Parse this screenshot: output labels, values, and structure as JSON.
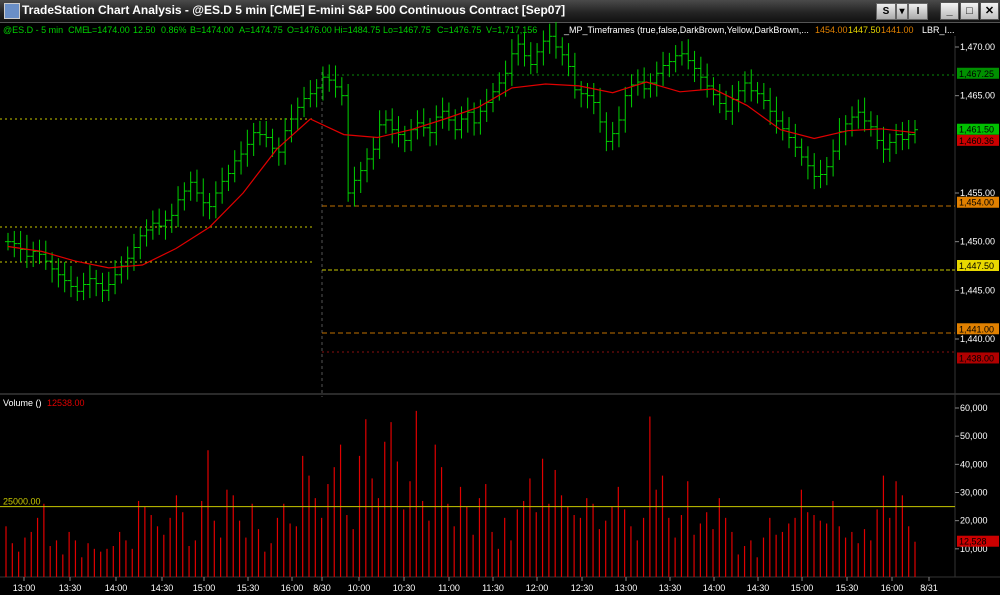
{
  "window": {
    "title": "TradeStation Chart Analysis - @ES.D  5 min  [CME] E-mini S&P 500 Continuous Contract [Sep07]",
    "btn_s": "S",
    "btn_i": "I",
    "minimize": "_",
    "maximize": "□",
    "close": "✕"
  },
  "header": {
    "symbol": "@ES.D - 5 min  CME",
    "last": "L=1474.00",
    "change": "12.50",
    "pct": "0.86%",
    "bid": "B=1474.00",
    "ask": "A=1474.75",
    "open": "O=1476.00",
    "high": "Hi=1484.75",
    "low": "Lo=1467.75",
    "close": "C=1476.75",
    "vol": "V=1,717,156",
    "indicator": "_MP_Timeframes (true,false,DarkBrown,Yellow,DarkBrown,...",
    "ind_v1": "1454.00",
    "ind_v2": "1447.50",
    "ind_v3": "1441.00",
    "ind_name2": "LBR_I..."
  },
  "volume_header": {
    "label": "Volume ()",
    "value": "12538.00"
  },
  "colors": {
    "bars": "#00d000",
    "ma": "#e00000",
    "volume": "#e00000",
    "guide": "#c8c800",
    "axis_text": "#ffffff",
    "background": "#000000"
  },
  "chart_data": [
    {
      "type": "ohlc",
      "ylim": [
        1436,
        1472
      ],
      "y_ticks": [
        "1,440.00",
        "1,445.00",
        "1,450.00",
        "1,455.00",
        "1,465.00",
        "1,470.00"
      ],
      "x_ticks": [
        "13:00",
        "13:30",
        "14:00",
        "14:30",
        "15:00",
        "15:30",
        "16:00",
        "8/30",
        "10:00",
        "10:30",
        "11:00",
        "11:30",
        "12:00",
        "12:30",
        "13:00",
        "13:30",
        "14:00",
        "14:30",
        "15:00",
        "15:30",
        "16:00",
        "8/31"
      ],
      "price_labels": [
        {
          "text": "1,467.25",
          "value": 1467.25,
          "bg": "#009000",
          "fg": "#000000"
        },
        {
          "text": "1,461.50",
          "value": 1461.5,
          "bg": "#00c000",
          "fg": "#000000"
        },
        {
          "text": "1,460.36",
          "value": 1460.36,
          "bg": "#cc0000",
          "fg": "#000000"
        },
        {
          "text": "1,454.00",
          "value": 1454.0,
          "bg": "#e08000",
          "fg": "#000000"
        },
        {
          "text": "1,447.50",
          "value": 1447.5,
          "bg": "#e8d800",
          "fg": "#000000"
        },
        {
          "text": "1,441.00",
          "value": 1441.0,
          "bg": "#e08000",
          "fg": "#000000"
        },
        {
          "text": "1,438.00",
          "value": 1438.0,
          "bg": "#b00000",
          "fg": "#000000"
        }
      ],
      "ohlc_closes": [
        1450.0,
        1449.8,
        1449.2,
        1448.5,
        1449.0,
        1448.7,
        1448.0,
        1447.2,
        1446.6,
        1446.0,
        1445.4,
        1444.9,
        1445.6,
        1446.2,
        1445.7,
        1445.0,
        1445.6,
        1446.6,
        1447.5,
        1448.3,
        1449.4,
        1450.6,
        1451.2,
        1451.9,
        1451.6,
        1452.2,
        1452.7,
        1454.3,
        1455.2,
        1456.1,
        1455.0,
        1454.0,
        1453.6,
        1455.0,
        1456.2,
        1457.0,
        1458.3,
        1459.0,
        1460.0,
        1461.2,
        1461.0,
        1460.7,
        1459.6,
        1459.2,
        1461.4,
        1462.6,
        1463.8,
        1464.7,
        1465.2,
        1465.8,
        1466.9,
        1466.6,
        1465.9,
        1465.0,
        1455.0,
        1456.3,
        1457.3,
        1458.5,
        1459.5,
        1462.0,
        1462.5,
        1461.5,
        1461.0,
        1460.4,
        1461.5,
        1462.2,
        1461.7,
        1461.2,
        1462.8,
        1463.4,
        1462.5,
        1461.5,
        1462.6,
        1463.3,
        1462.2,
        1463.4,
        1464.3,
        1465.4,
        1466.3,
        1467.3,
        1469.3,
        1470.3,
        1469.1,
        1468.2,
        1469.5,
        1470.6,
        1471.1,
        1470.0,
        1469.2,
        1468.0,
        1465.6,
        1465.2,
        1465.0,
        1464.3,
        1462.3,
        1460.3,
        1461.1,
        1462.5,
        1465.0,
        1466.1,
        1466.4,
        1465.7,
        1466.3,
        1467.3,
        1468.1,
        1468.5,
        1469.1,
        1469.3,
        1468.6,
        1467.8,
        1466.9,
        1466.0,
        1465.1,
        1464.2,
        1463.4,
        1464.6,
        1465.5,
        1466.3,
        1465.5,
        1465.2,
        1464.5,
        1463.4,
        1462.4,
        1461.6,
        1460.7,
        1459.7,
        1458.7,
        1457.8,
        1456.7,
        1456.9,
        1457.7,
        1459.3,
        1461.3,
        1462.1,
        1462.8,
        1463.3,
        1462.4,
        1461.8,
        1460.4,
        1459.5,
        1460.2,
        1461.0,
        1460.5,
        1461.0,
        1461.5
      ],
      "ma_values": [
        1449.5,
        1449.0,
        1448.0,
        1447.3,
        1447.6,
        1449.3,
        1451.5,
        1455.0,
        1459.5,
        1462.6,
        1461.0,
        1460.7,
        1461.5,
        1462.6,
        1463.8,
        1465.8,
        1466.2,
        1466.0,
        1465.3,
        1466.4,
        1465.4,
        1465.7,
        1464.0,
        1461.5,
        1460.6,
        1461.4,
        1461.6,
        1461.2
      ]
    },
    {
      "type": "bar",
      "title": "Volume ()",
      "ylim": [
        0,
        65000
      ],
      "y_ticks": [
        "10,000",
        "20,000",
        "30,000",
        "40,000",
        "50,000",
        "60,000"
      ],
      "reference_line": {
        "text": "25000.00",
        "value": 25000
      },
      "last_label": {
        "text": "12,528",
        "value": 12528
      },
      "values": [
        18000,
        12000,
        9000,
        14000,
        16000,
        21000,
        26000,
        11000,
        13000,
        8000,
        16000,
        13000,
        7000,
        12000,
        10000,
        9000,
        10000,
        11000,
        16000,
        13000,
        10000,
        27000,
        25000,
        22000,
        18000,
        15000,
        21000,
        29000,
        23000,
        11000,
        13000,
        27000,
        45000,
        20000,
        14000,
        31000,
        29000,
        20000,
        14000,
        26000,
        17000,
        9000,
        12000,
        21000,
        26000,
        19000,
        18000,
        43000,
        36000,
        28000,
        21000,
        33000,
        39000,
        47000,
        22000,
        17000,
        43000,
        56000,
        35000,
        28000,
        48000,
        55000,
        41000,
        24000,
        34000,
        59000,
        27000,
        20000,
        47000,
        39000,
        26000,
        18000,
        32000,
        25000,
        15000,
        28000,
        33000,
        16000,
        10000,
        21000,
        13000,
        24000,
        27000,
        35000,
        23000,
        42000,
        26000,
        38000,
        29000,
        25000,
        22000,
        21000,
        28000,
        26000,
        17000,
        20000,
        25000,
        32000,
        24000,
        18000,
        13000,
        21000,
        57000,
        31000,
        36000,
        21000,
        14000,
        22000,
        34000,
        15000,
        19000,
        23000,
        17000,
        28000,
        21000,
        16000,
        8000,
        11000,
        13000,
        7000,
        14000,
        21000,
        15000,
        16000,
        19000,
        21000,
        31000,
        23000,
        22000,
        20000,
        19000,
        27000,
        18000,
        14000,
        16000,
        12000,
        17000,
        13000,
        24000,
        36000,
        21000,
        34000,
        29000,
        18000,
        12528
      ]
    }
  ]
}
